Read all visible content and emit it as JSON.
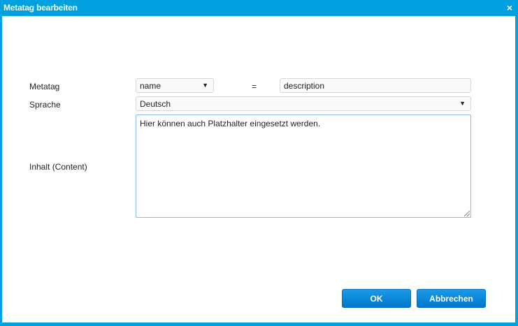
{
  "dialog": {
    "title": "Metatag bearbeiten"
  },
  "form": {
    "metatag_label": "Metatag",
    "metatag_type": "name",
    "equals": "=",
    "metatag_value": "description",
    "language_label": "Sprache",
    "language": "Deutsch",
    "content_label": "Inhalt (Content)",
    "content": "Hier können auch Platzhalter eingesetzt werden."
  },
  "buttons": {
    "ok": "OK",
    "cancel": "Abbrechen"
  },
  "icons": {
    "close": "×",
    "dropdown": "▼"
  }
}
